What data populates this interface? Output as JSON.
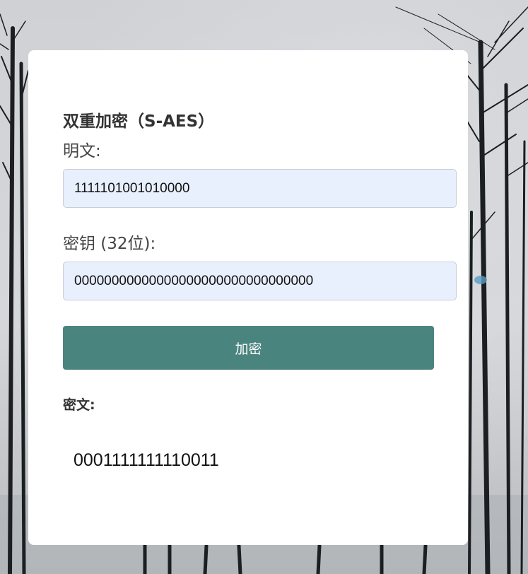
{
  "form": {
    "title": "双重加密（S-AES）",
    "plaintext_label": "明文:",
    "plaintext_value": "1111101001010000",
    "key_label": "密钥 (32位):",
    "key_value": "00000000000000000000000000000000",
    "encrypt_button_label": "加密",
    "ciphertext_label": "密文:",
    "ciphertext_value": "0001111111110011"
  },
  "colors": {
    "button": "#4a847e",
    "input_background": "#e8f0fe",
    "card": "#ffffff"
  },
  "background": {
    "icon": "winter-trees-photo"
  }
}
